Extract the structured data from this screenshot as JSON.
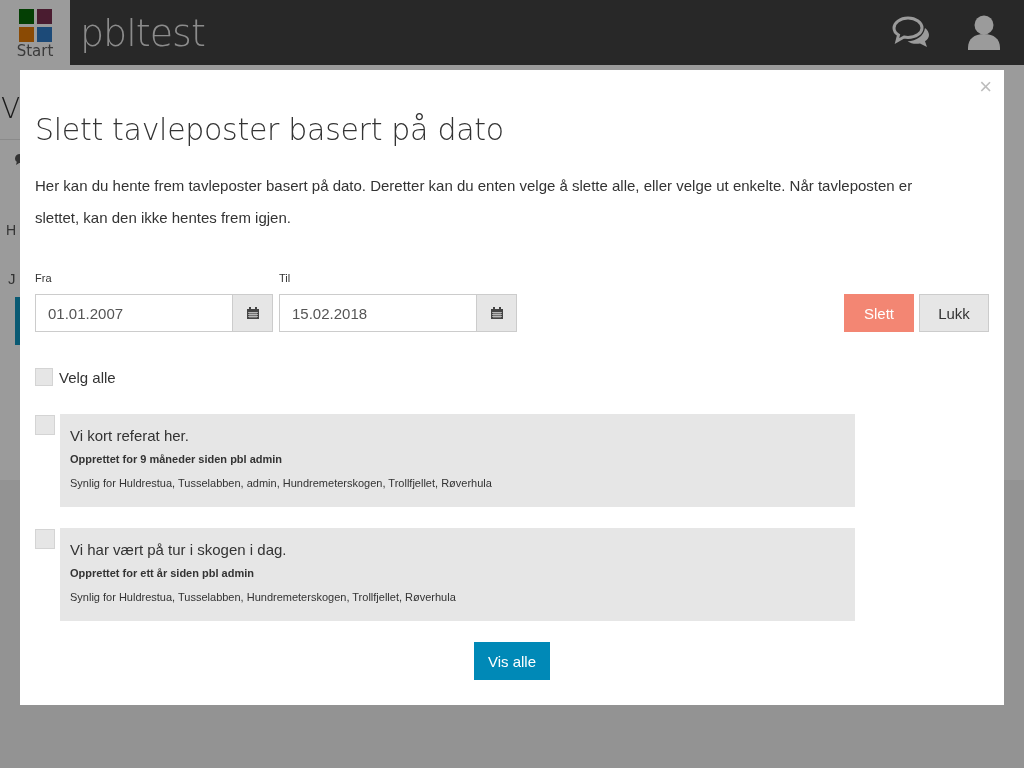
{
  "header": {
    "start_label": "Start",
    "site_title": "pbltest"
  },
  "background_page": {
    "heading": "V",
    "line_1": "H",
    "line_2": "J"
  },
  "dialog": {
    "close": "×",
    "title": "Slett tavleposter basert på dato",
    "description": "Her kan du hente frem tavleposter basert på dato. Deretter kan du enten velge å slette alle, eller velge ut enkelte. Når tavleposten er slettet, kan den ikke hentes frem igjen.",
    "from": {
      "label": "Fra",
      "value": "01.01.2007"
    },
    "to": {
      "label": "Til",
      "value": "15.02.2018"
    },
    "buttons": [
      {
        "label": "Slett",
        "kind": "danger"
      },
      {
        "label": "Lukk",
        "kind": "default"
      }
    ],
    "select_all": {
      "label": "Velg alle",
      "checked": false
    },
    "posts": [
      {
        "text": "Vi kort referat her.",
        "created": "Opprettet for 9 måneder siden pbl admin",
        "visible_to": "Synlig for Huldrestua, Tusselabben, admin, Hundremeterskogen, Trollfjellet, Røverhula",
        "checked": false
      },
      {
        "text": "Vi har vært på tur i skogen i dag.",
        "created": "Opprettet for ett år siden pbl admin",
        "visible_to": "Synlig for Huldrestua, Tusselabben, Hundremeterskogen, Trollfjellet, Røverhula",
        "checked": false
      }
    ],
    "show_all": "Vis alle"
  }
}
